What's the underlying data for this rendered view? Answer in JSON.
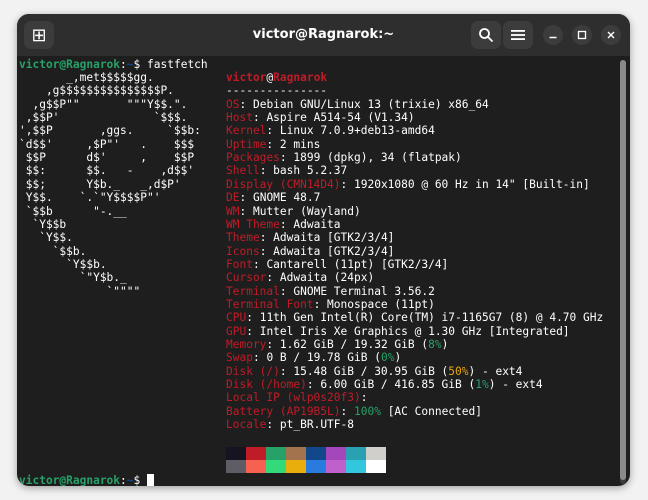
{
  "window": {
    "title": "victor@Ragnarok:~"
  },
  "header": {
    "new_tab_glyph": "⊞",
    "search_glyph": "⌕",
    "menu_glyph": "☰",
    "minimize_glyph": "—",
    "maximize_glyph": "□",
    "close_glyph": "✕"
  },
  "prompt": {
    "user_host": "victor@Ragnarok",
    "path_sep": ":",
    "path": "~",
    "symbol": "$ ",
    "command": "fastfetch"
  },
  "ascii_logo": [
    "       _,met$$$$$gg.",
    "    ,g$$$$$$$$$$$$$$$P.",
    "  ,g$$P\"\"       \"\"\"Y$$.\".",
    " ,$$P'              `$$$.",
    "',$$P       ,ggs.     `$$b:",
    "`d$$'     ,$P\"'   .    $$$",
    " $$P      d$'     ,    $$P",
    " $$:      $$.   -    ,d$$'",
    " $$;      Y$b._   _,d$P'",
    " Y$$.    `.`\"Y$$$$P\"'",
    " `$$b      \"-.__",
    "  `Y$$b",
    "   `Y$$.",
    "     `$$b.",
    "       `Y$$b.",
    "         `\"Y$b._",
    "             `\"\"\"\""
  ],
  "info": {
    "user": "victor",
    "at": "@",
    "host": "Ragnarok",
    "separator": "---------------",
    "rows": [
      {
        "key": "OS",
        "value": "Debian GNU/Linux 13 (trixie) x86_64"
      },
      {
        "key": "Host",
        "value": "Aspire A514-54 (V1.34)"
      },
      {
        "key": "Kernel",
        "value": "Linux 7.0.9+deb13-amd64"
      },
      {
        "key": "Uptime",
        "value": "2 mins"
      },
      {
        "key": "Packages",
        "value": "1899 (dpkg), 34 (flatpak)"
      },
      {
        "key": "Shell",
        "value": "bash 5.2.37"
      },
      {
        "key": "Display (CMN14D4)",
        "value": "1920x1080 @ 60 Hz in 14\" [Built-in]"
      },
      {
        "key": "DE",
        "value": "GNOME 48.7"
      },
      {
        "key": "WM",
        "value": "Mutter (Wayland)"
      },
      {
        "key": "WM Theme",
        "value": "Adwaita"
      },
      {
        "key": "Theme",
        "value": "Adwaita [GTK2/3/4]"
      },
      {
        "key": "Icons",
        "value": "Adwaita [GTK2/3/4]"
      },
      {
        "key": "Font",
        "value": "Cantarell (11pt) [GTK2/3/4]"
      },
      {
        "key": "Cursor",
        "value": "Adwaita (24px)"
      },
      {
        "key": "Terminal",
        "value": "GNOME Terminal 3.56.2"
      },
      {
        "key": "Terminal Font",
        "value": "Monospace (11pt)"
      },
      {
        "key": "CPU",
        "value": "11th Gen Intel(R) Core(TM) i7-1165G7 (8) @ 4.70 GHz"
      },
      {
        "key": "GPU",
        "value": "Intel Iris Xe Graphics @ 1.30 GHz [Integrated]"
      },
      {
        "key": "Memory",
        "value_pre": "1.62 GiB / 19.32 GiB (",
        "pct": "8%",
        "pct_color": "#26a269",
        "value_post": ")"
      },
      {
        "key": "Swap",
        "value_pre": "0 B / 19.78 GiB (",
        "pct": "0%",
        "pct_color": "#26a269",
        "value_post": ")"
      },
      {
        "key": "Disk (/)",
        "value_pre": "15.48 GiB / 30.95 GiB (",
        "pct": "50%",
        "pct_color": "#e5a50a",
        "value_post": ") - ext4"
      },
      {
        "key": "Disk (/home)",
        "value_pre": "6.00 GiB / 416.85 GiB (",
        "pct": "1%",
        "pct_color": "#26a269",
        "value_post": ") - ext4"
      },
      {
        "key": "Local IP (wlp0s20f3)",
        "value": ""
      },
      {
        "key": "Battery (AP19B5L)",
        "value_pre": "",
        "pct": "100%",
        "pct_color": "#26a269",
        "value_post": " [AC Connected]"
      },
      {
        "key": "Locale",
        "value": "pt_BR.UTF-8"
      }
    ]
  },
  "palette": {
    "top": [
      "#171421",
      "#c01c28",
      "#26a269",
      "#a2734c",
      "#12488b",
      "#a347ba",
      "#2aa1b3",
      "#d0cfcc"
    ],
    "bottom": [
      "#5e5c64",
      "#f66151",
      "#33da7a",
      "#e9ad0c",
      "#2a7bde",
      "#c061cb",
      "#33c7de",
      "#ffffff"
    ]
  },
  "colors": {
    "prompt_user": "#26a269",
    "prompt_path": "#12488b",
    "key": "#c01c28",
    "background": "#1e1e1e"
  }
}
